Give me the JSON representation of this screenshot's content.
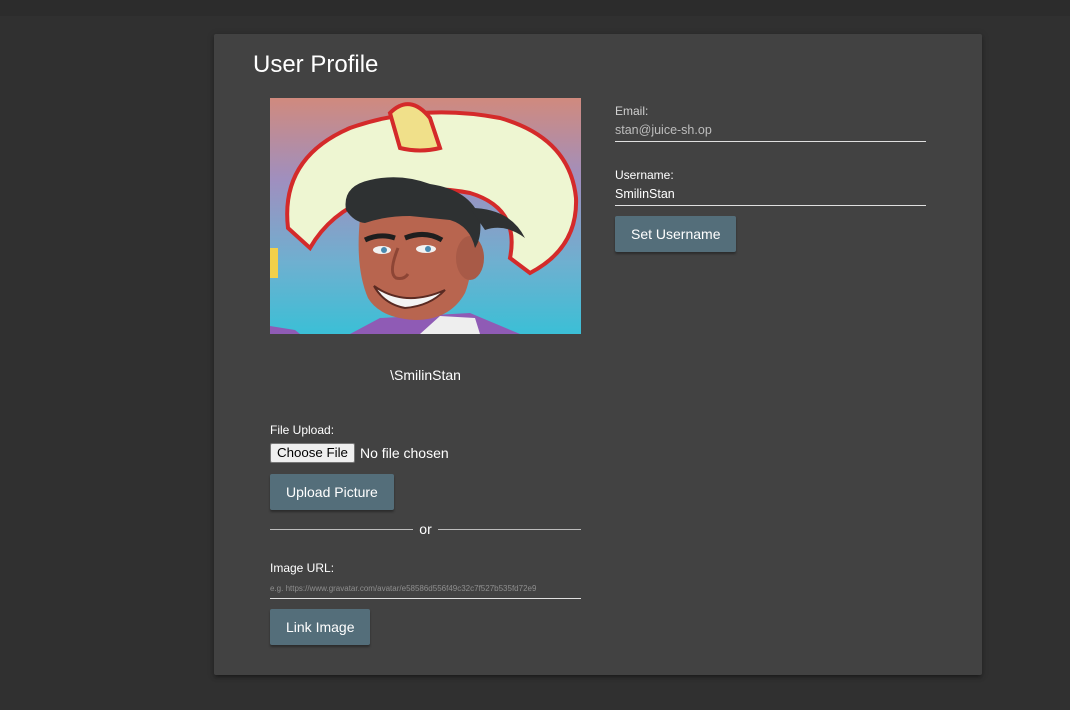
{
  "profile": {
    "title": "User Profile",
    "avatar_caption": "\\SmilinStan",
    "file_upload_label": "File Upload:",
    "choose_file_label": "Choose File",
    "file_status": "No file chosen",
    "upload_button": "Upload Picture",
    "or_text": "or",
    "image_url_label": "Image URL:",
    "image_url_placeholder": "e.g. https://www.gravatar.com/avatar/e58586d556f49c32c7f527b535fd72e9",
    "link_button": "Link Image",
    "email_label": "Email:",
    "email_value": "stan@juice-sh.op",
    "username_label": "Username:",
    "username_value": "SmilinStan",
    "set_username_button": "Set Username"
  },
  "colors": {
    "background": "#303030",
    "card": "#424242",
    "button": "#546e7a"
  }
}
